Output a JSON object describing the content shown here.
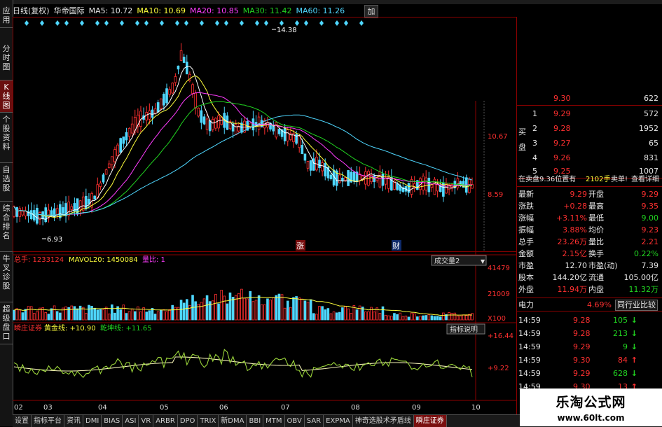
{
  "left_tabs": [
    "应用",
    "分时图",
    "K线图",
    "个股资料",
    "自选股",
    "综合排名",
    "牛叉诊股",
    "超级盘口"
  ],
  "left_tab_active": 2,
  "header": {
    "period": "日线(复权)",
    "stock_name": "华帝国际",
    "ma5": "MA5: 10.72",
    "ma10": "MA10: 10.69",
    "ma20": "MA20: 10.85",
    "ma30": "MA30: 11.42",
    "ma60": "MA60: 11.26",
    "add_button": "加"
  },
  "colors": {
    "up": "#ff3030",
    "down": "#4fd7ff",
    "ma5": "#ffffff",
    "ma10": "#ffff3c",
    "ma20": "#ff3cff",
    "ma30": "#21d421",
    "ma60": "#4fd7ff"
  },
  "price_chart": {
    "high_label": "14.38",
    "low_label": "6.93",
    "y_ticks": [
      "10.67",
      "8.59"
    ],
    "event_markers": [
      "涨",
      "财"
    ]
  },
  "volume_chart": {
    "total_label": "总手: 1233124",
    "mavol20_label": "MAVOL20: 1450084",
    "ratio_label": "量比: 1",
    "dropdown": "成交量2",
    "y_ticks": [
      "41479",
      "21009",
      "X100"
    ]
  },
  "indicator_chart": {
    "name": "瞬庄证券",
    "gold_label": "黄金线: +10.90",
    "bull_label": "乾坤线: +11.65",
    "explain_button": "指标说明",
    "y_ticks": [
      "+16.44",
      "+9.22"
    ]
  },
  "x_axis": [
    "02",
    "03",
    "04",
    "05",
    "06",
    "07",
    "08",
    "09",
    "10"
  ],
  "order_book": {
    "top_partial": {
      "price": "9.30",
      "vol": "622"
    },
    "bid_label": "买盘",
    "bids": [
      {
        "lvl": "1",
        "price": "9.29",
        "vol": "572"
      },
      {
        "lvl": "2",
        "price": "9.28",
        "vol": "1952"
      },
      {
        "lvl": "3",
        "price": "9.27",
        "vol": "65"
      },
      {
        "lvl": "4",
        "price": "9.26",
        "vol": "831"
      },
      {
        "lvl": "5",
        "price": "9.25",
        "vol": "1007"
      }
    ]
  },
  "notice": {
    "text": "在卖盘9.36位置有",
    "qty": "2102手",
    "tag": "卖单!",
    "link": "查看详细"
  },
  "quote": [
    {
      "l": "最新",
      "lv": "9.29",
      "r": "开盘",
      "rv": "9.29"
    },
    {
      "l": "涨跌",
      "lv": "+0.28",
      "r": "最高",
      "rv": "9.35"
    },
    {
      "l": "涨幅",
      "lv": "+3.11%",
      "r": "最低",
      "rv": "9.00"
    },
    {
      "l": "振幅",
      "lv": "3.88%",
      "r": "均价",
      "rv": "9.23"
    },
    {
      "l": "总手",
      "lv": "23.26万",
      "r": "量比",
      "rv": "2.21"
    },
    {
      "l": "金额",
      "lv": "2.15亿",
      "r": "换手",
      "rv": "0.22%"
    },
    {
      "l": "市盈",
      "lv": "12.70",
      "r": "市盈(动)",
      "rv": "7.39"
    },
    {
      "l": "股本",
      "lv": "144.20亿",
      "r": "流通",
      "rv": "105.00亿"
    },
    {
      "l": "外盘",
      "lv": "11.94万",
      "r": "内盘",
      "rv": "11.32万"
    }
  ],
  "sector": {
    "name": "电力",
    "change": "4.69%",
    "button": "同行业比较"
  },
  "trades": [
    {
      "t": "14:59",
      "p": "9.28",
      "v": "105",
      "dir": "down"
    },
    {
      "t": "14:59",
      "p": "9.28",
      "v": "213",
      "dir": "down"
    },
    {
      "t": "14:59",
      "p": "9.29",
      "v": "9",
      "dir": "down"
    },
    {
      "t": "14:59",
      "p": "9.30",
      "v": "84",
      "dir": "up"
    },
    {
      "t": "14:59",
      "p": "9.29",
      "v": "628",
      "dir": "down"
    },
    {
      "t": "14:59",
      "p": "9.30",
      "v": "13",
      "dir": "up"
    }
  ],
  "bottom_tabs": [
    "设置",
    "指标平台",
    "资讯",
    "DMI",
    "BIAS",
    "ASI",
    "VR",
    "ARBR",
    "DPO",
    "TRIX",
    "新DMA",
    "BBI",
    "MTM",
    "OBV",
    "SAR",
    "EXPMA",
    "神奇选股术矛盾线",
    "瞬庄证券"
  ],
  "bottom_tab_active": 17,
  "watermark": {
    "line1": "乐淘公式网",
    "line2": "www.60lt.com"
  }
}
